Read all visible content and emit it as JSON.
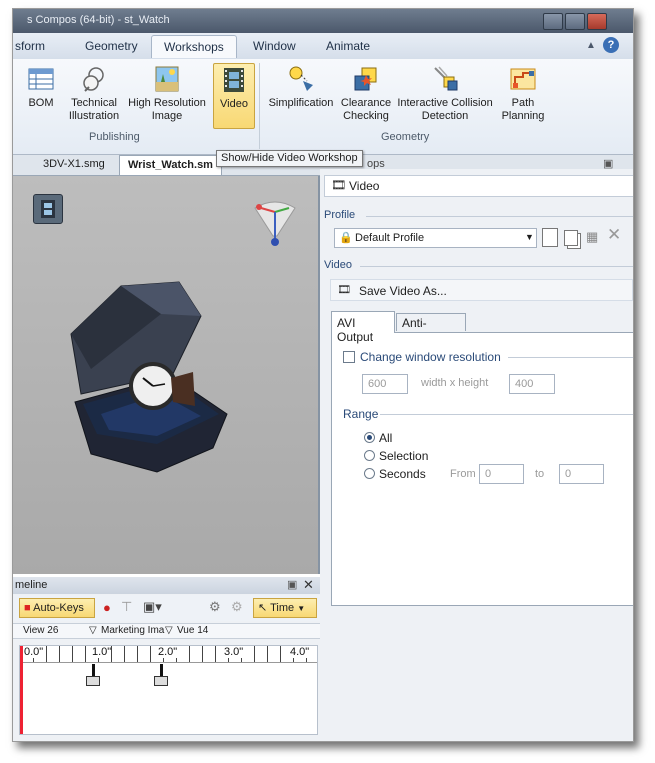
{
  "window": {
    "title_left": "s Compos",
    "title_mid": "(64-bit)",
    "title_right": "st_Watch"
  },
  "menu": {
    "tabs": [
      "sform",
      "Geometry",
      "Workshops",
      "Window",
      "Animate"
    ],
    "active_tab": "Workshops"
  },
  "ribbon": {
    "publishing": {
      "label": "Publishing",
      "buttons": [
        "BOM",
        "Technical Illustration",
        "High Resolution Image",
        "Video"
      ]
    },
    "geometry": {
      "label": "Geometry",
      "buttons": [
        "Simplification",
        "Clearance Checking",
        "Interactive Collision Detection",
        "Path Planning"
      ]
    },
    "selected_button": "Video"
  },
  "doc_tabs": {
    "tab1": "3DV-X1.smg",
    "tab2": "Wrist_Watch.sm",
    "panel_tab_tail": "ops"
  },
  "tooltip": "Show/Hide Video Workshop",
  "timeline": {
    "title": "meline",
    "auto_keys": "Auto-Keys",
    "time_button": "Time",
    "markers": [
      "View 26",
      "Marketing Ima",
      "Vue 14"
    ],
    "ticks": [
      "0.0\"",
      "1.0\"",
      "2.0\"",
      "3.0\"",
      "4.0\""
    ]
  },
  "video_panel": {
    "title": "Video",
    "profile_section": "Profile",
    "profile_value": "Default Profile",
    "video_section": "Video",
    "save_video": "Save Video As...",
    "tabs": [
      "AVI Output",
      "Anti-Aliasing"
    ],
    "active_tab": "AVI Output",
    "change_resolution": "Change window resolution",
    "change_resolution_checked": false,
    "width": "600",
    "size_label": "width x height",
    "height": "400",
    "range_section": "Range",
    "range_options": [
      "All",
      "Selection",
      "Seconds"
    ],
    "range_selected": "All",
    "from_label": "From",
    "from_value": "0",
    "to_label": "to",
    "to_value": "0"
  },
  "colors": {
    "accent_yellow": "#f8d874",
    "ribbon_bg": "#e4ebf4",
    "section_blue": "#2a4a78",
    "viewport_gray": "#b3b3b3"
  }
}
